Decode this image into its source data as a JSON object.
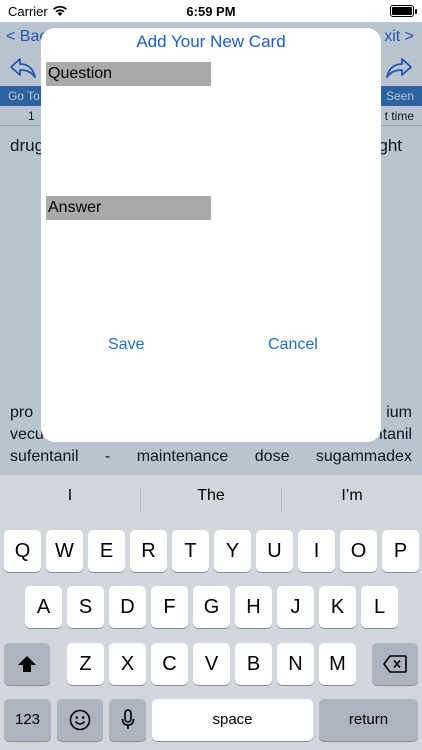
{
  "status_bar": {
    "carrier": "Carrier",
    "time": "6:59 PM"
  },
  "background": {
    "nav": {
      "back": "< Bac",
      "exit": "xit >"
    },
    "info_bar": {
      "go": "Go To",
      "seen": "Seen"
    },
    "count_bar": {
      "num": "1",
      "last_time": "t time"
    },
    "content": {
      "left": "drug",
      "right": "ght"
    },
    "lower_text": {
      "line1_left": "pro",
      "line1_right": "ium",
      "line2_left": "vecu",
      "line2_right": "ntanil",
      "line3": [
        "sufentanil",
        "-",
        "maintenance",
        "dose",
        "sugammadex"
      ]
    }
  },
  "modal": {
    "title": "Add Your New Card",
    "question_label": "Question",
    "answer_label": "Answer",
    "save": "Save",
    "cancel": "Cancel"
  },
  "keyboard": {
    "suggestions": [
      "I",
      "The",
      "I’m"
    ],
    "row1": [
      "Q",
      "W",
      "E",
      "R",
      "T",
      "Y",
      "U",
      "I",
      "O",
      "P"
    ],
    "row2": [
      "A",
      "S",
      "D",
      "F",
      "G",
      "H",
      "J",
      "K",
      "L"
    ],
    "row3": [
      "Z",
      "X",
      "C",
      "V",
      "B",
      "N",
      "M"
    ],
    "numbers_key": "123",
    "space": "space",
    "return": "return"
  }
}
